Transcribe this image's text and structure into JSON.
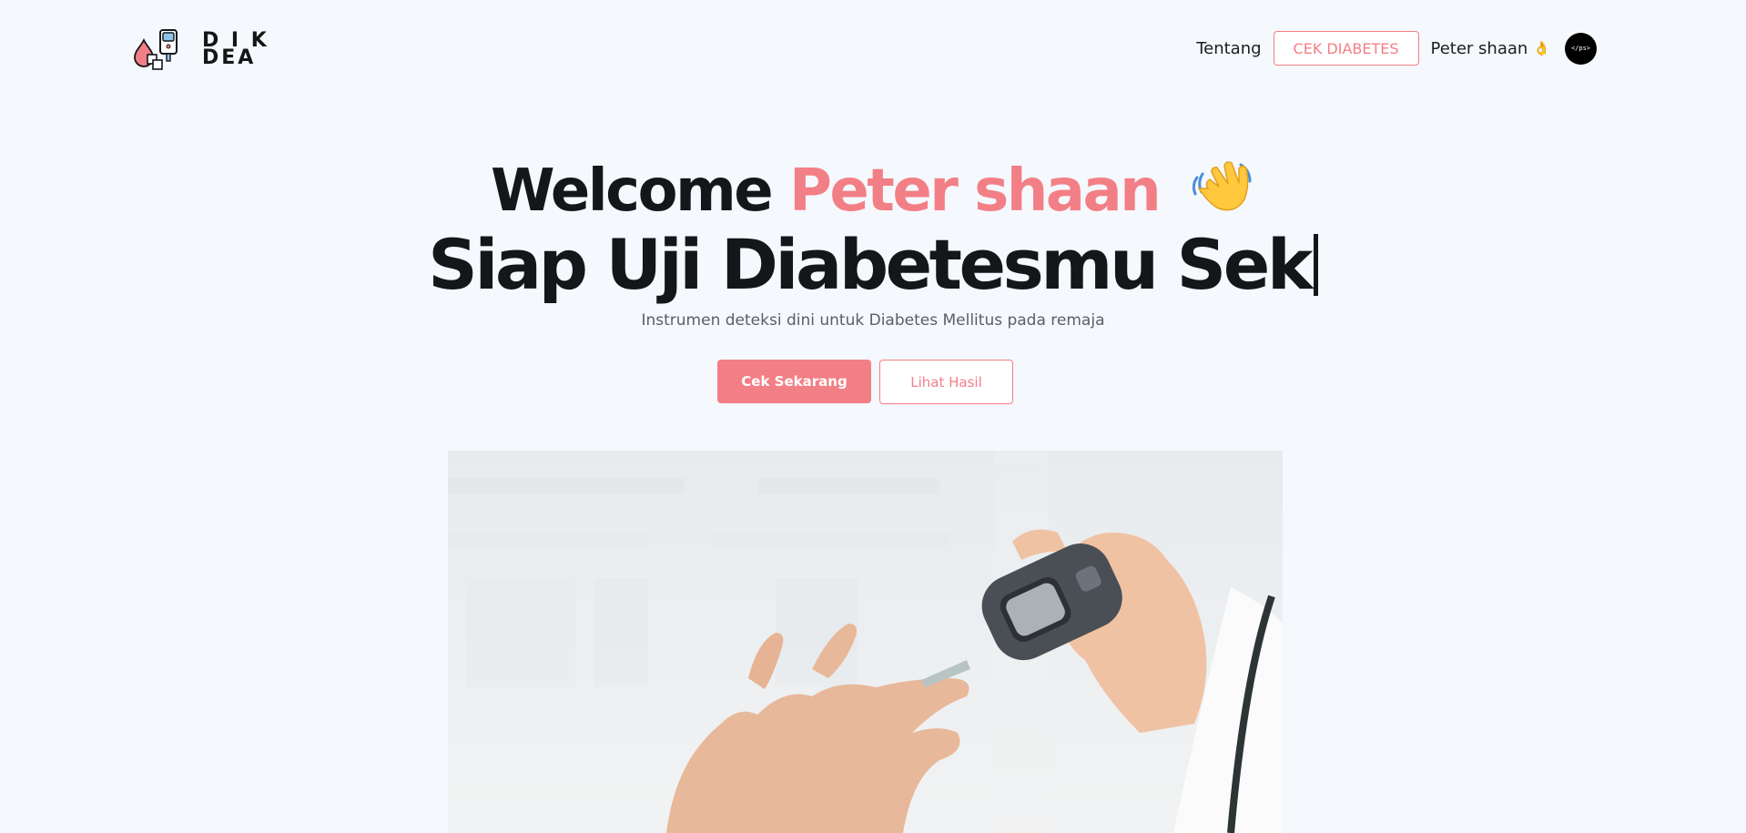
{
  "brand": {
    "line1": "D I K",
    "line2": "DEA"
  },
  "nav": {
    "link_about": "Tentang",
    "cta": "CEK DIABETES",
    "user_name": "Peter shaan",
    "user_emoji": "👌",
    "avatar_text": "</ps>"
  },
  "hero": {
    "welcome": "Welcome",
    "name": "Peter shaan",
    "typed_text": "Siap Uji Diabetesmu Sek",
    "subtitle": "Instrumen deteksi dini untuk Diabetes Mellitus pada remaja",
    "primary_button": "Cek Sekarang",
    "secondary_button": "Lihat Hasil"
  },
  "colors": {
    "accent": "#f37f86",
    "background": "#f5f8fc",
    "text": "#15161a"
  },
  "icons": {
    "logo": "glucose-meter-blood-drop-icon",
    "wave": "waving-hand-icon",
    "user_emoji": "ok-hand-icon"
  }
}
